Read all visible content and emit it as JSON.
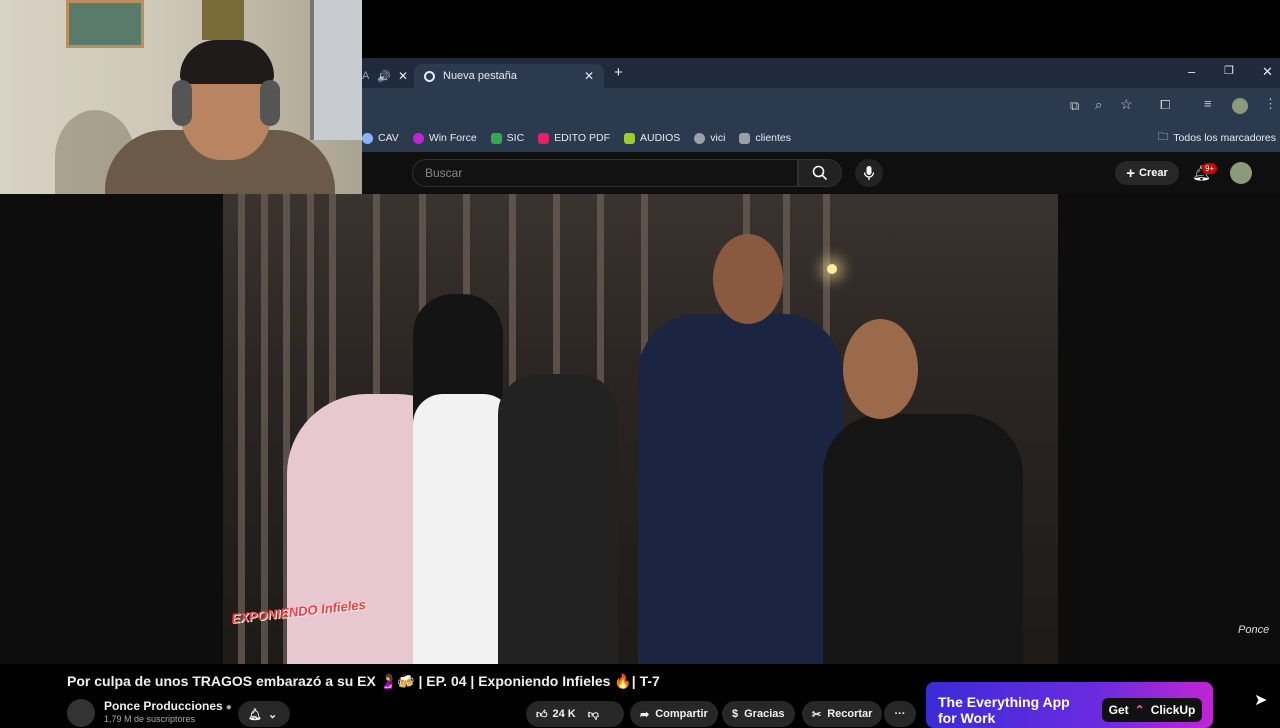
{
  "browser": {
    "tabs": [
      {
        "label": "",
        "active": false
      },
      {
        "label": "Nueva pestaña",
        "active": true
      }
    ],
    "new_tab_symbol": "+",
    "window_controls": {
      "minimize": "–",
      "restore": "❐",
      "close": "✕"
    },
    "bookmarks": [
      {
        "label": "CAV",
        "color": "#8ab4f8"
      },
      {
        "label": "Win Force",
        "color": "#c026d3"
      },
      {
        "label": "SIC",
        "color": "#34a853"
      },
      {
        "label": "EDITO PDF",
        "color": "#e91e63"
      },
      {
        "label": "AUDIOS",
        "color": "#9acd32"
      },
      {
        "label": "vici",
        "color": "#9aa0a6"
      },
      {
        "label": "clientes",
        "color": "#9aa0a6"
      }
    ],
    "all_bookmarks": "Todos los marcadores"
  },
  "youtube": {
    "search_placeholder": "Buscar",
    "create_label": "Crear",
    "notifications_badge": "9+",
    "video": {
      "title": "Por culpa de unos TRAGOS embarazó a su EX 🤰🍻 | EP. 04 | Exponiendo Infieles 🔥| T-7",
      "overlay_logo": "EXPONIENDO Infieles",
      "watermark": "Ponce"
    },
    "channel": {
      "name": "Ponce Producciones",
      "subscribers": "1,79 M de suscriptores"
    },
    "actions": {
      "likes": "24 K",
      "share": "Compartir",
      "thanks": "Gracias",
      "clip": "Recortar",
      "more": "···"
    },
    "ad": {
      "headline": "The Everything App for Work",
      "cta": "Get",
      "brand": "ClickUp"
    }
  },
  "colors": {
    "accent": "#ff0000",
    "chrome_bg": "#2c3a4f",
    "yt_bg": "#0f0f0f"
  }
}
